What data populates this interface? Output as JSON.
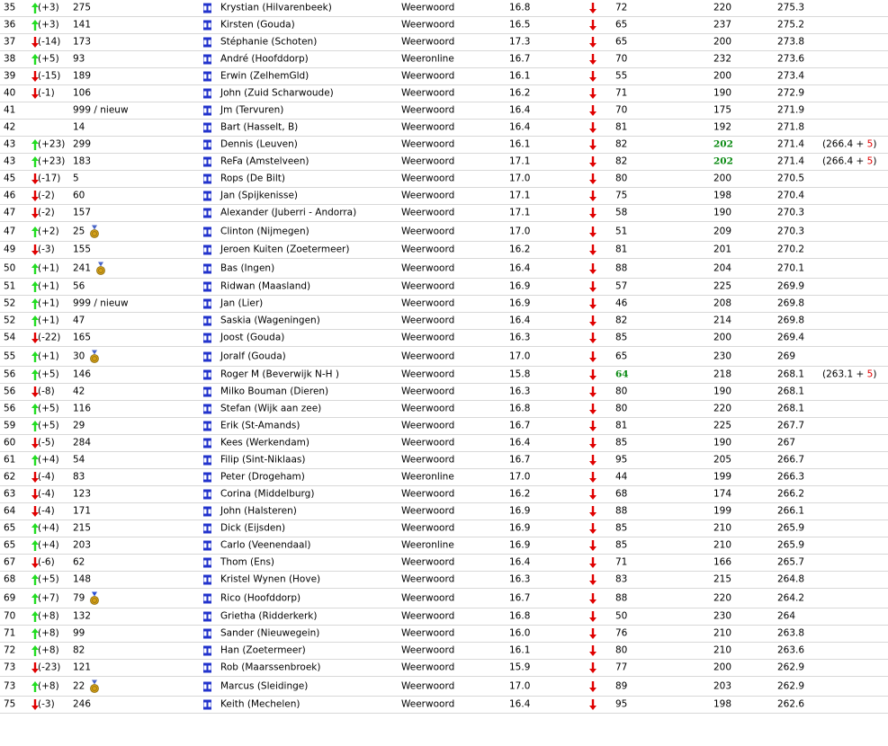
{
  "colors": {
    "up_arrow": "#22dd22",
    "down_arrow": "#e00000",
    "record_highlight": "#0a8a12",
    "bonus": "#e00000",
    "flag_blue": "#2233cc",
    "medal": "#d4a018",
    "divider": "#d8d8d8"
  },
  "icons": {
    "up": "up-arrow-icon",
    "down": "down-arrow-icon",
    "flag": "flag-icon",
    "medal": "medal-icon",
    "trend_column": "down-arrow-icon"
  },
  "rows": [
    {
      "rank": "35",
      "trend": "up",
      "delta": "(+3)",
      "prev": "275",
      "medal": "",
      "name": "Krystian (Hilvarenbeek)",
      "source": "Weerwoord",
      "t1": "16.8",
      "v2": "72",
      "v2_hl": false,
      "v3": "220",
      "v3_hl": false,
      "score": "275.3",
      "extra": "",
      "bonus": ""
    },
    {
      "rank": "36",
      "trend": "up",
      "delta": "(+3)",
      "prev": "141",
      "medal": "",
      "name": "Kirsten (Gouda)",
      "source": "Weerwoord",
      "t1": "16.5",
      "v2": "65",
      "v2_hl": false,
      "v3": "237",
      "v3_hl": false,
      "score": "275.2",
      "extra": "",
      "bonus": ""
    },
    {
      "rank": "37",
      "trend": "down",
      "delta": "(-14)",
      "prev": "173",
      "medal": "",
      "name": "Stéphanie (Schoten)",
      "source": "Weerwoord",
      "t1": "17.3",
      "v2": "65",
      "v2_hl": false,
      "v3": "200",
      "v3_hl": false,
      "score": "273.8",
      "extra": "",
      "bonus": ""
    },
    {
      "rank": "38",
      "trend": "up",
      "delta": "(+5)",
      "prev": "93",
      "medal": "",
      "name": "André (Hoofddorp)",
      "source": "Weeronline",
      "t1": "16.7",
      "v2": "70",
      "v2_hl": false,
      "v3": "232",
      "v3_hl": false,
      "score": "273.6",
      "extra": "",
      "bonus": ""
    },
    {
      "rank": "39",
      "trend": "down",
      "delta": "(-15)",
      "prev": "189",
      "medal": "",
      "name": "Erwin (ZelhemGld)",
      "source": "Weerwoord",
      "t1": "16.1",
      "v2": "55",
      "v2_hl": false,
      "v3": "200",
      "v3_hl": false,
      "score": "273.4",
      "extra": "",
      "bonus": ""
    },
    {
      "rank": "40",
      "trend": "down",
      "delta": "(-1)",
      "prev": "106",
      "medal": "",
      "name": "John (Zuid Scharwoude)",
      "source": "Weerwoord",
      "t1": "16.2",
      "v2": "71",
      "v2_hl": false,
      "v3": "190",
      "v3_hl": false,
      "score": "272.9",
      "extra": "",
      "bonus": ""
    },
    {
      "rank": "41",
      "trend": "",
      "delta": "",
      "prev": "999 / nieuw",
      "medal": "",
      "name": "Jm (Tervuren)",
      "source": "Weerwoord",
      "t1": "16.4",
      "v2": "70",
      "v2_hl": false,
      "v3": "175",
      "v3_hl": false,
      "score": "271.9",
      "extra": "",
      "bonus": ""
    },
    {
      "rank": "42",
      "trend": "",
      "delta": "",
      "prev": "14",
      "medal": "",
      "name": "Bart (Hasselt, B)",
      "source": "Weerwoord",
      "t1": "16.4",
      "v2": "81",
      "v2_hl": false,
      "v3": "192",
      "v3_hl": false,
      "score": "271.8",
      "extra": "",
      "bonus": ""
    },
    {
      "rank": "43",
      "trend": "up",
      "delta": "(+23)",
      "prev": "299",
      "medal": "",
      "name": "Dennis (Leuven)",
      "source": "Weerwoord",
      "t1": "16.1",
      "v2": "82",
      "v2_hl": false,
      "v3": "202",
      "v3_hl": true,
      "score": "271.4",
      "extra": "(266.4 + ",
      "bonus": "5",
      "extra_end": ")"
    },
    {
      "rank": "43",
      "trend": "up",
      "delta": "(+23)",
      "prev": "183",
      "medal": "",
      "name": "ReFa (Amstelveen)",
      "source": "Weerwoord",
      "t1": "17.1",
      "v2": "82",
      "v2_hl": false,
      "v3": "202",
      "v3_hl": true,
      "score": "271.4",
      "extra": "(266.4 + ",
      "bonus": "5",
      "extra_end": ")"
    },
    {
      "rank": "45",
      "trend": "down",
      "delta": "(-17)",
      "prev": "5",
      "medal": "",
      "name": "Rops (De Bilt)",
      "source": "Weerwoord",
      "t1": "17.0",
      "v2": "80",
      "v2_hl": false,
      "v3": "200",
      "v3_hl": false,
      "score": "270.5",
      "extra": "",
      "bonus": ""
    },
    {
      "rank": "46",
      "trend": "down",
      "delta": "(-2)",
      "prev": "60",
      "medal": "",
      "name": "Jan (Spijkenisse)",
      "source": "Weerwoord",
      "t1": "17.1",
      "v2": "75",
      "v2_hl": false,
      "v3": "198",
      "v3_hl": false,
      "score": "270.4",
      "extra": "",
      "bonus": ""
    },
    {
      "rank": "47",
      "trend": "down",
      "delta": "(-2)",
      "prev": "157",
      "medal": "",
      "name": "Alexander (Juberri - Andorra)",
      "source": "Weerwoord",
      "t1": "17.1",
      "v2": "58",
      "v2_hl": false,
      "v3": "190",
      "v3_hl": false,
      "score": "270.3",
      "extra": "",
      "bonus": ""
    },
    {
      "rank": "47",
      "trend": "up",
      "delta": "(+2)",
      "prev": "25",
      "medal": "bronze",
      "name": "Clinton (Nijmegen)",
      "source": "Weerwoord",
      "t1": "17.0",
      "v2": "51",
      "v2_hl": false,
      "v3": "209",
      "v3_hl": false,
      "score": "270.3",
      "extra": "",
      "bonus": ""
    },
    {
      "rank": "49",
      "trend": "down",
      "delta": "(-3)",
      "prev": "155",
      "medal": "",
      "name": "Jeroen Kuiten (Zoetermeer)",
      "source": "Weerwoord",
      "t1": "16.2",
      "v2": "81",
      "v2_hl": false,
      "v3": "201",
      "v3_hl": false,
      "score": "270.2",
      "extra": "",
      "bonus": ""
    },
    {
      "rank": "50",
      "trend": "up",
      "delta": "(+1)",
      "prev": "241",
      "medal": "bronze",
      "name": "Bas (Ingen)",
      "source": "Weerwoord",
      "t1": "16.4",
      "v2": "88",
      "v2_hl": false,
      "v3": "204",
      "v3_hl": false,
      "score": "270.1",
      "extra": "",
      "bonus": ""
    },
    {
      "rank": "51",
      "trend": "up",
      "delta": "(+1)",
      "prev": "56",
      "medal": "",
      "name": "Ridwan (Maasland)",
      "source": "Weerwoord",
      "t1": "16.9",
      "v2": "57",
      "v2_hl": false,
      "v3": "225",
      "v3_hl": false,
      "score": "269.9",
      "extra": "",
      "bonus": ""
    },
    {
      "rank": "52",
      "trend": "up",
      "delta": "(+1)",
      "prev": "999 / nieuw",
      "medal": "",
      "name": "Jan (Lier)",
      "source": "Weerwoord",
      "t1": "16.9",
      "v2": "46",
      "v2_hl": false,
      "v3": "208",
      "v3_hl": false,
      "score": "269.8",
      "extra": "",
      "bonus": ""
    },
    {
      "rank": "52",
      "trend": "up",
      "delta": "(+1)",
      "prev": "47",
      "medal": "",
      "name": "Saskia (Wageningen)",
      "source": "Weerwoord",
      "t1": "16.4",
      "v2": "82",
      "v2_hl": false,
      "v3": "214",
      "v3_hl": false,
      "score": "269.8",
      "extra": "",
      "bonus": ""
    },
    {
      "rank": "54",
      "trend": "down",
      "delta": "(-22)",
      "prev": "165",
      "medal": "",
      "name": "Joost (Gouda)",
      "source": "Weerwoord",
      "t1": "16.3",
      "v2": "85",
      "v2_hl": false,
      "v3": "200",
      "v3_hl": false,
      "score": "269.4",
      "extra": "",
      "bonus": ""
    },
    {
      "rank": "55",
      "trend": "up",
      "delta": "(+1)",
      "prev": "30",
      "medal": "bronze",
      "name": "Joralf (Gouda)",
      "source": "Weerwoord",
      "t1": "17.0",
      "v2": "65",
      "v2_hl": false,
      "v3": "230",
      "v3_hl": false,
      "score": "269",
      "extra": "",
      "bonus": ""
    },
    {
      "rank": "56",
      "trend": "up",
      "delta": "(+5)",
      "prev": "146",
      "medal": "",
      "name": "Roger M (Beverwijk N-H )",
      "source": "Weerwoord",
      "t1": "15.8",
      "v2": "64",
      "v2_hl": true,
      "v3": "218",
      "v3_hl": false,
      "score": "268.1",
      "extra": "(263.1 + ",
      "bonus": "5",
      "extra_end": ")"
    },
    {
      "rank": "56",
      "trend": "down",
      "delta": "(-8)",
      "prev": "42",
      "medal": "",
      "name": "Milko Bouman (Dieren)",
      "source": "Weerwoord",
      "t1": "16.3",
      "v2": "80",
      "v2_hl": false,
      "v3": "190",
      "v3_hl": false,
      "score": "268.1",
      "extra": "",
      "bonus": ""
    },
    {
      "rank": "56",
      "trend": "up",
      "delta": "(+5)",
      "prev": "116",
      "medal": "",
      "name": "Stefan (Wijk aan zee)",
      "source": "Weerwoord",
      "t1": "16.8",
      "v2": "80",
      "v2_hl": false,
      "v3": "220",
      "v3_hl": false,
      "score": "268.1",
      "extra": "",
      "bonus": ""
    },
    {
      "rank": "59",
      "trend": "up",
      "delta": "(+5)",
      "prev": "29",
      "medal": "",
      "name": "Erik (St-Amands)",
      "source": "Weerwoord",
      "t1": "16.7",
      "v2": "81",
      "v2_hl": false,
      "v3": "225",
      "v3_hl": false,
      "score": "267.7",
      "extra": "",
      "bonus": ""
    },
    {
      "rank": "60",
      "trend": "down",
      "delta": "(-5)",
      "prev": "284",
      "medal": "",
      "name": "Kees (Werkendam)",
      "source": "Weerwoord",
      "t1": "16.4",
      "v2": "85",
      "v2_hl": false,
      "v3": "190",
      "v3_hl": false,
      "score": "267",
      "extra": "",
      "bonus": ""
    },
    {
      "rank": "61",
      "trend": "up",
      "delta": "(+4)",
      "prev": "54",
      "medal": "",
      "name": "Filip (Sint-Niklaas)",
      "source": "Weerwoord",
      "t1": "16.7",
      "v2": "95",
      "v2_hl": false,
      "v3": "205",
      "v3_hl": false,
      "score": "266.7",
      "extra": "",
      "bonus": ""
    },
    {
      "rank": "62",
      "trend": "down",
      "delta": "(-4)",
      "prev": "83",
      "medal": "",
      "name": "Peter (Drogeham)",
      "source": "Weeronline",
      "t1": "17.0",
      "v2": "44",
      "v2_hl": false,
      "v3": "199",
      "v3_hl": false,
      "score": "266.3",
      "extra": "",
      "bonus": ""
    },
    {
      "rank": "63",
      "trend": "down",
      "delta": "(-4)",
      "prev": "123",
      "medal": "",
      "name": "Corina (Middelburg)",
      "source": "Weerwoord",
      "t1": "16.2",
      "v2": "68",
      "v2_hl": false,
      "v3": "174",
      "v3_hl": false,
      "score": "266.2",
      "extra": "",
      "bonus": ""
    },
    {
      "rank": "64",
      "trend": "down",
      "delta": "(-4)",
      "prev": "171",
      "medal": "",
      "name": "John (Halsteren)",
      "source": "Weerwoord",
      "t1": "16.9",
      "v2": "88",
      "v2_hl": false,
      "v3": "199",
      "v3_hl": false,
      "score": "266.1",
      "extra": "",
      "bonus": ""
    },
    {
      "rank": "65",
      "trend": "up",
      "delta": "(+4)",
      "prev": "215",
      "medal": "",
      "name": "Dick (Eijsden)",
      "source": "Weerwoord",
      "t1": "16.9",
      "v2": "85",
      "v2_hl": false,
      "v3": "210",
      "v3_hl": false,
      "score": "265.9",
      "extra": "",
      "bonus": ""
    },
    {
      "rank": "65",
      "trend": "up",
      "delta": "(+4)",
      "prev": "203",
      "medal": "",
      "name": "Carlo (Veenendaal)",
      "source": "Weeronline",
      "t1": "16.9",
      "v2": "85",
      "v2_hl": false,
      "v3": "210",
      "v3_hl": false,
      "score": "265.9",
      "extra": "",
      "bonus": ""
    },
    {
      "rank": "67",
      "trend": "down",
      "delta": "(-6)",
      "prev": "62",
      "medal": "",
      "name": "Thom (Ens)",
      "source": "Weerwoord",
      "t1": "16.4",
      "v2": "71",
      "v2_hl": false,
      "v3": "166",
      "v3_hl": false,
      "score": "265.7",
      "extra": "",
      "bonus": ""
    },
    {
      "rank": "68",
      "trend": "up",
      "delta": "(+5)",
      "prev": "148",
      "medal": "",
      "name": "Kristel Wynen (Hove)",
      "source": "Weerwoord",
      "t1": "16.3",
      "v2": "83",
      "v2_hl": false,
      "v3": "215",
      "v3_hl": false,
      "score": "264.8",
      "extra": "",
      "bonus": ""
    },
    {
      "rank": "69",
      "trend": "up",
      "delta": "(+7)",
      "prev": "79",
      "medal": "blue",
      "name": "Rico (Hoofddorp)",
      "source": "Weerwoord",
      "t1": "16.7",
      "v2": "88",
      "v2_hl": false,
      "v3": "220",
      "v3_hl": false,
      "score": "264.2",
      "extra": "",
      "bonus": ""
    },
    {
      "rank": "70",
      "trend": "up",
      "delta": "(+8)",
      "prev": "132",
      "medal": "",
      "name": "Grietha (Ridderkerk)",
      "source": "Weerwoord",
      "t1": "16.8",
      "v2": "50",
      "v2_hl": false,
      "v3": "230",
      "v3_hl": false,
      "score": "264",
      "extra": "",
      "bonus": ""
    },
    {
      "rank": "71",
      "trend": "up",
      "delta": "(+8)",
      "prev": "99",
      "medal": "",
      "name": "Sander (Nieuwegein)",
      "source": "Weerwoord",
      "t1": "16.0",
      "v2": "76",
      "v2_hl": false,
      "v3": "210",
      "v3_hl": false,
      "score": "263.8",
      "extra": "",
      "bonus": ""
    },
    {
      "rank": "72",
      "trend": "up",
      "delta": "(+8)",
      "prev": "82",
      "medal": "",
      "name": "Han (Zoetermeer)",
      "source": "Weerwoord",
      "t1": "16.1",
      "v2": "80",
      "v2_hl": false,
      "v3": "210",
      "v3_hl": false,
      "score": "263.6",
      "extra": "",
      "bonus": ""
    },
    {
      "rank": "73",
      "trend": "down",
      "delta": "(-23)",
      "prev": "121",
      "medal": "",
      "name": "Rob (Maarssenbroek)",
      "source": "Weerwoord",
      "t1": "15.9",
      "v2": "77",
      "v2_hl": false,
      "v3": "200",
      "v3_hl": false,
      "score": "262.9",
      "extra": "",
      "bonus": ""
    },
    {
      "rank": "73",
      "trend": "up",
      "delta": "(+8)",
      "prev": "22",
      "medal": "bronze",
      "name": "Marcus (Sleidinge)",
      "source": "Weerwoord",
      "t1": "17.0",
      "v2": "89",
      "v2_hl": false,
      "v3": "203",
      "v3_hl": false,
      "score": "262.9",
      "extra": "",
      "bonus": ""
    },
    {
      "rank": "75",
      "trend": "down",
      "delta": "(-3)",
      "prev": "246",
      "medal": "",
      "name": "Keith (Mechelen)",
      "source": "Weerwoord",
      "t1": "16.4",
      "v2": "95",
      "v2_hl": false,
      "v3": "198",
      "v3_hl": false,
      "score": "262.6",
      "extra": "",
      "bonus": ""
    }
  ]
}
